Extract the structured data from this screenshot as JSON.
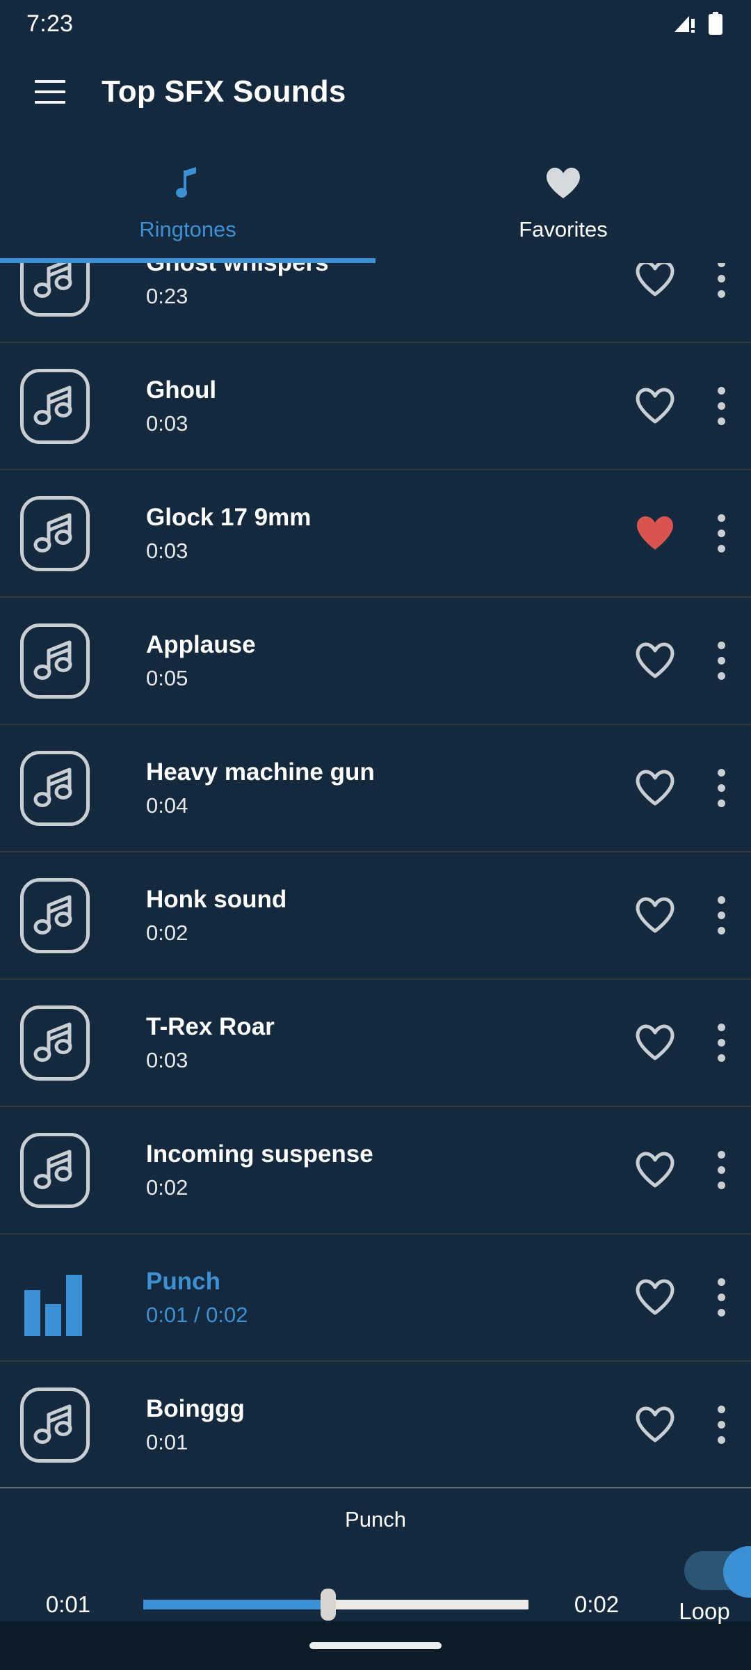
{
  "status_bar": {
    "time": "7:23",
    "signal_icon": "signal-no-service-icon",
    "battery_icon": "battery-full-icon"
  },
  "app_bar": {
    "menu_icon": "hamburger-menu-icon",
    "title": "Top SFX Sounds"
  },
  "tabs": [
    {
      "label": "Ringtones",
      "icon": "music-note-icon",
      "active": true
    },
    {
      "label": "Favorites",
      "icon": "heart-filled-icon",
      "active": false
    }
  ],
  "colors": {
    "background": "#14293d",
    "accent": "#3c90d4",
    "favorite_on": "#d9534f",
    "icon_outline": "#c9ced3",
    "divider": "#33383c",
    "nav_background": "#0c1c29"
  },
  "list": {
    "items": [
      {
        "title": "Ghost whispers",
        "duration": "0:23",
        "favorite": false,
        "playing": false,
        "icon": "music-note-icon"
      },
      {
        "title": "Ghoul",
        "duration": "0:03",
        "favorite": false,
        "playing": false,
        "icon": "music-note-icon"
      },
      {
        "title": "Glock 17 9mm",
        "duration": "0:03",
        "favorite": true,
        "playing": false,
        "icon": "music-note-icon"
      },
      {
        "title": "Applause",
        "duration": "0:05",
        "favorite": false,
        "playing": false,
        "icon": "music-note-icon"
      },
      {
        "title": "Heavy machine gun",
        "duration": "0:04",
        "favorite": false,
        "playing": false,
        "icon": "music-note-icon"
      },
      {
        "title": "Honk sound",
        "duration": "0:02",
        "favorite": false,
        "playing": false,
        "icon": "music-note-icon"
      },
      {
        "title": "T-Rex Roar",
        "duration": "0:03",
        "favorite": false,
        "playing": false,
        "icon": "music-note-icon"
      },
      {
        "title": "Incoming suspense",
        "duration": "0:02",
        "favorite": false,
        "playing": false,
        "icon": "music-note-icon"
      },
      {
        "title": "Punch",
        "duration": "0:01 / 0:02",
        "favorite": false,
        "playing": true,
        "icon": "equalizer-icon"
      },
      {
        "title": "Boinggg",
        "duration": "0:01",
        "favorite": false,
        "playing": false,
        "icon": "music-note-icon"
      }
    ]
  },
  "player": {
    "title": "Punch",
    "elapsed": "0:01",
    "total": "0:02",
    "progress_percent": 48,
    "loop_label": "Loop",
    "loop_on": true
  },
  "nav_bar": {
    "handle": "gesture-home-handle"
  }
}
